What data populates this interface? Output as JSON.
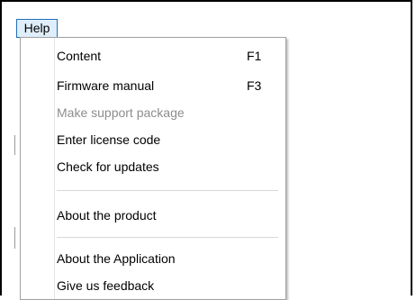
{
  "menubar": {
    "help_label": "Help"
  },
  "help_menu": {
    "items": [
      {
        "label": "Content",
        "shortcut": "F1",
        "enabled": true
      },
      {
        "label": "Firmware manual",
        "shortcut": "F3",
        "enabled": true
      },
      {
        "label": "Make support package",
        "shortcut": "",
        "enabled": false
      },
      {
        "label": "Enter license code",
        "shortcut": "",
        "enabled": true
      },
      {
        "label": "Check for updates",
        "shortcut": "",
        "enabled": true
      },
      {
        "label": "About the product",
        "shortcut": "",
        "enabled": true
      },
      {
        "label": "About the Application",
        "shortcut": "",
        "enabled": true
      },
      {
        "label": "Give us feedback",
        "shortcut": "",
        "enabled": true
      }
    ]
  },
  "colors": {
    "menu_highlight_border": "#1f6fb8",
    "menu_highlight_fill": "#dfeefb",
    "disabled_text": "#8d8d8d"
  }
}
